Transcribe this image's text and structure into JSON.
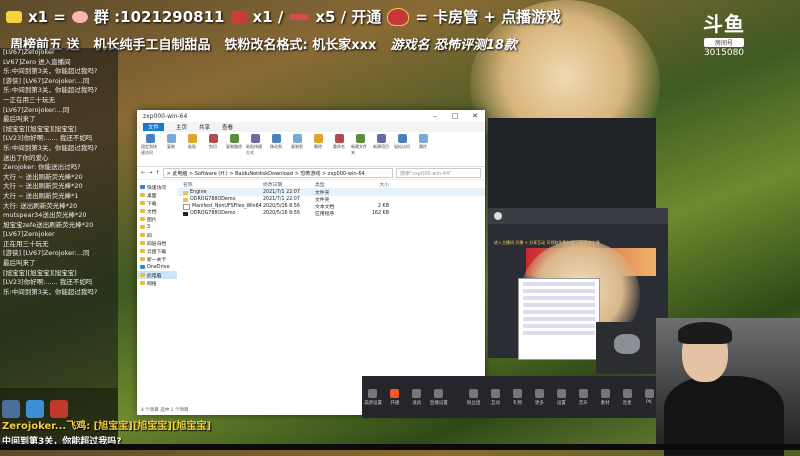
{
  "banner": {
    "gift1_count": "x1 =",
    "group": "群 :1021290811",
    "gift2_count": "x1 /",
    "gift3_count": "x5 / 开通",
    "card_text": "= 卡房管 + 点播游戏",
    "line2": [
      "周榜前五 送",
      "机长纯手工自制甜品",
      "铁粉改名格式: 机长家xxx",
      "游戏名 恐怖评测18款"
    ],
    "logo_mark": "斗鱼",
    "logo_sub": "房间号",
    "room_id": "3015080"
  },
  "chat": {
    "lines": [
      {
        "user": "",
        "text": "[LV67]Zerojoker"
      },
      {
        "user": "欢迎",
        "text": "LV67]Zero  进入直播间"
      },
      {
        "user": "",
        "text": "乐:中间到第3关，你能超过我吗?"
      },
      {
        "user": "",
        "text": "[游侠] [LV67]Zerojoker:...同"
      },
      {
        "user": "",
        "text": "乐:中间到第3关，你能超过我吗?"
      },
      {
        "user": "",
        "text": "一正在用三十玩无"
      },
      {
        "user": "",
        "text": "[LV67]Zerojoker:...同"
      },
      {
        "user": "",
        "text": "最后叫来了"
      },
      {
        "user": "",
        "text": "[旭宝宝][旭宝宝][旭宝宝]"
      },
      {
        "user": "",
        "text": "[LV23]你好啊:...... 我还不如吗"
      },
      {
        "user": "",
        "text": "乐:中间到第3关，你能超过我吗?"
      },
      {
        "user": "",
        "text": "送出了你的爱心"
      },
      {
        "user": "",
        "text": "Zerojoker: 你能送出过吗?"
      },
      {
        "user": "",
        "text": "大行 ~ 送出刷新荧光棒*20"
      },
      {
        "user": "",
        "text": "大行 ~ 送出刷新荧光棒*20"
      },
      {
        "user": "",
        "text": "大行 ~ 送出刷新荧光棒*1"
      },
      {
        "user": "",
        "text": "大行: 送出刷新荧光棒*20"
      },
      {
        "user": "",
        "text": "mutspear34送出荧光棒*20"
      },
      {
        "user": "",
        "text": "旭宝宝zefe送出刷新荧光棒*20"
      },
      {
        "user": "",
        "text": ""
      },
      {
        "user": "",
        "text": "[LV67]Zerojoker"
      },
      {
        "user": "",
        "text": "正在用三十玩无"
      },
      {
        "user": "",
        "text": "[游侠] [LV67]Zerojoker:...同"
      },
      {
        "user": "",
        "text": "最后叫来了"
      },
      {
        "user": "",
        "text": "[旭宝宝][旭宝宝][旭宝宝]"
      },
      {
        "user": "",
        "text": "[LV23]你好啊:...... 我还不如吗"
      },
      {
        "user": "",
        "text": "乐:中间到第3关，你能超过我吗?"
      }
    ]
  },
  "explorer": {
    "title": "zxp000-win-64",
    "tabs": [
      "文件",
      "主页",
      "共享",
      "查看"
    ],
    "ribbon": [
      "固定到快速访问",
      "复制",
      "粘贴",
      "剪切",
      "复制路径",
      "粘贴快捷方式",
      "移动到",
      "复制到",
      "删除",
      "重命名",
      "新建文件夹",
      "新建项目",
      "轻松访问",
      "属性",
      "打开",
      "编辑",
      "历史记录",
      "全部选择",
      "全部取消",
      "反向选择"
    ],
    "ribbon_groups": [
      "剪贴板",
      "组织",
      "新建",
      "打开",
      "选择"
    ],
    "address": "> 此电脑 > Software (H:) > BaiduNetdiskDownload > 恐怖游戏 > zxp000-win-64",
    "search_placeholder": "搜索\"zxp000-win-64\"",
    "nav": [
      "快速访问",
      "桌面",
      "下载",
      "文档",
      "图片",
      "3",
      "四",
      "四层归档",
      "云盘下载",
      "新一关卡",
      "OneDrive",
      "此电脑",
      "网络"
    ],
    "columns": [
      "名称",
      "修改日期",
      "类型",
      "大小"
    ],
    "files": [
      {
        "name": "Engine",
        "date": "2021/7/1 22:07",
        "type": "文件夹",
        "size": ""
      },
      {
        "name": "ODROG788ODemo",
        "date": "2021/7/1 22:07",
        "type": "文件夹",
        "size": ""
      },
      {
        "name": "Manifest_NonUFSFiles_Win64",
        "date": "2020/5/16 8:56",
        "type": "文本文档",
        "size": "2 KB"
      },
      {
        "name": "ODROG788ODemo",
        "date": "2020/5/16 8:56",
        "type": "应用程序",
        "size": "162 KB"
      }
    ],
    "status": "4 个项目  选中 1 个项目"
  },
  "live_window": {
    "promo": "进入主播间 开播 + 分享互动 可领取免费礼物 斗鱼星选主播"
  },
  "toolbar": [
    "美颜设置",
    "开播",
    "道具",
    "直播设置",
    "粉丝团",
    "互动",
    "礼物",
    "更多",
    "设置",
    "音乐",
    "素材",
    "连麦",
    "PK"
  ],
  "danmu": {
    "line1": "Zerojoker...飞鸡: [旭宝宝][旭宝宝][旭宝宝]",
    "line2": "中间到第3关，你能超过我吗?"
  },
  "desktop_icons": [
    "recycle-bin-icon",
    "computer-icon",
    "game-icon"
  ],
  "colors": {
    "accent": "#1979ca",
    "danmu": "#f4d03f",
    "live_orange": "#f05a2a"
  }
}
